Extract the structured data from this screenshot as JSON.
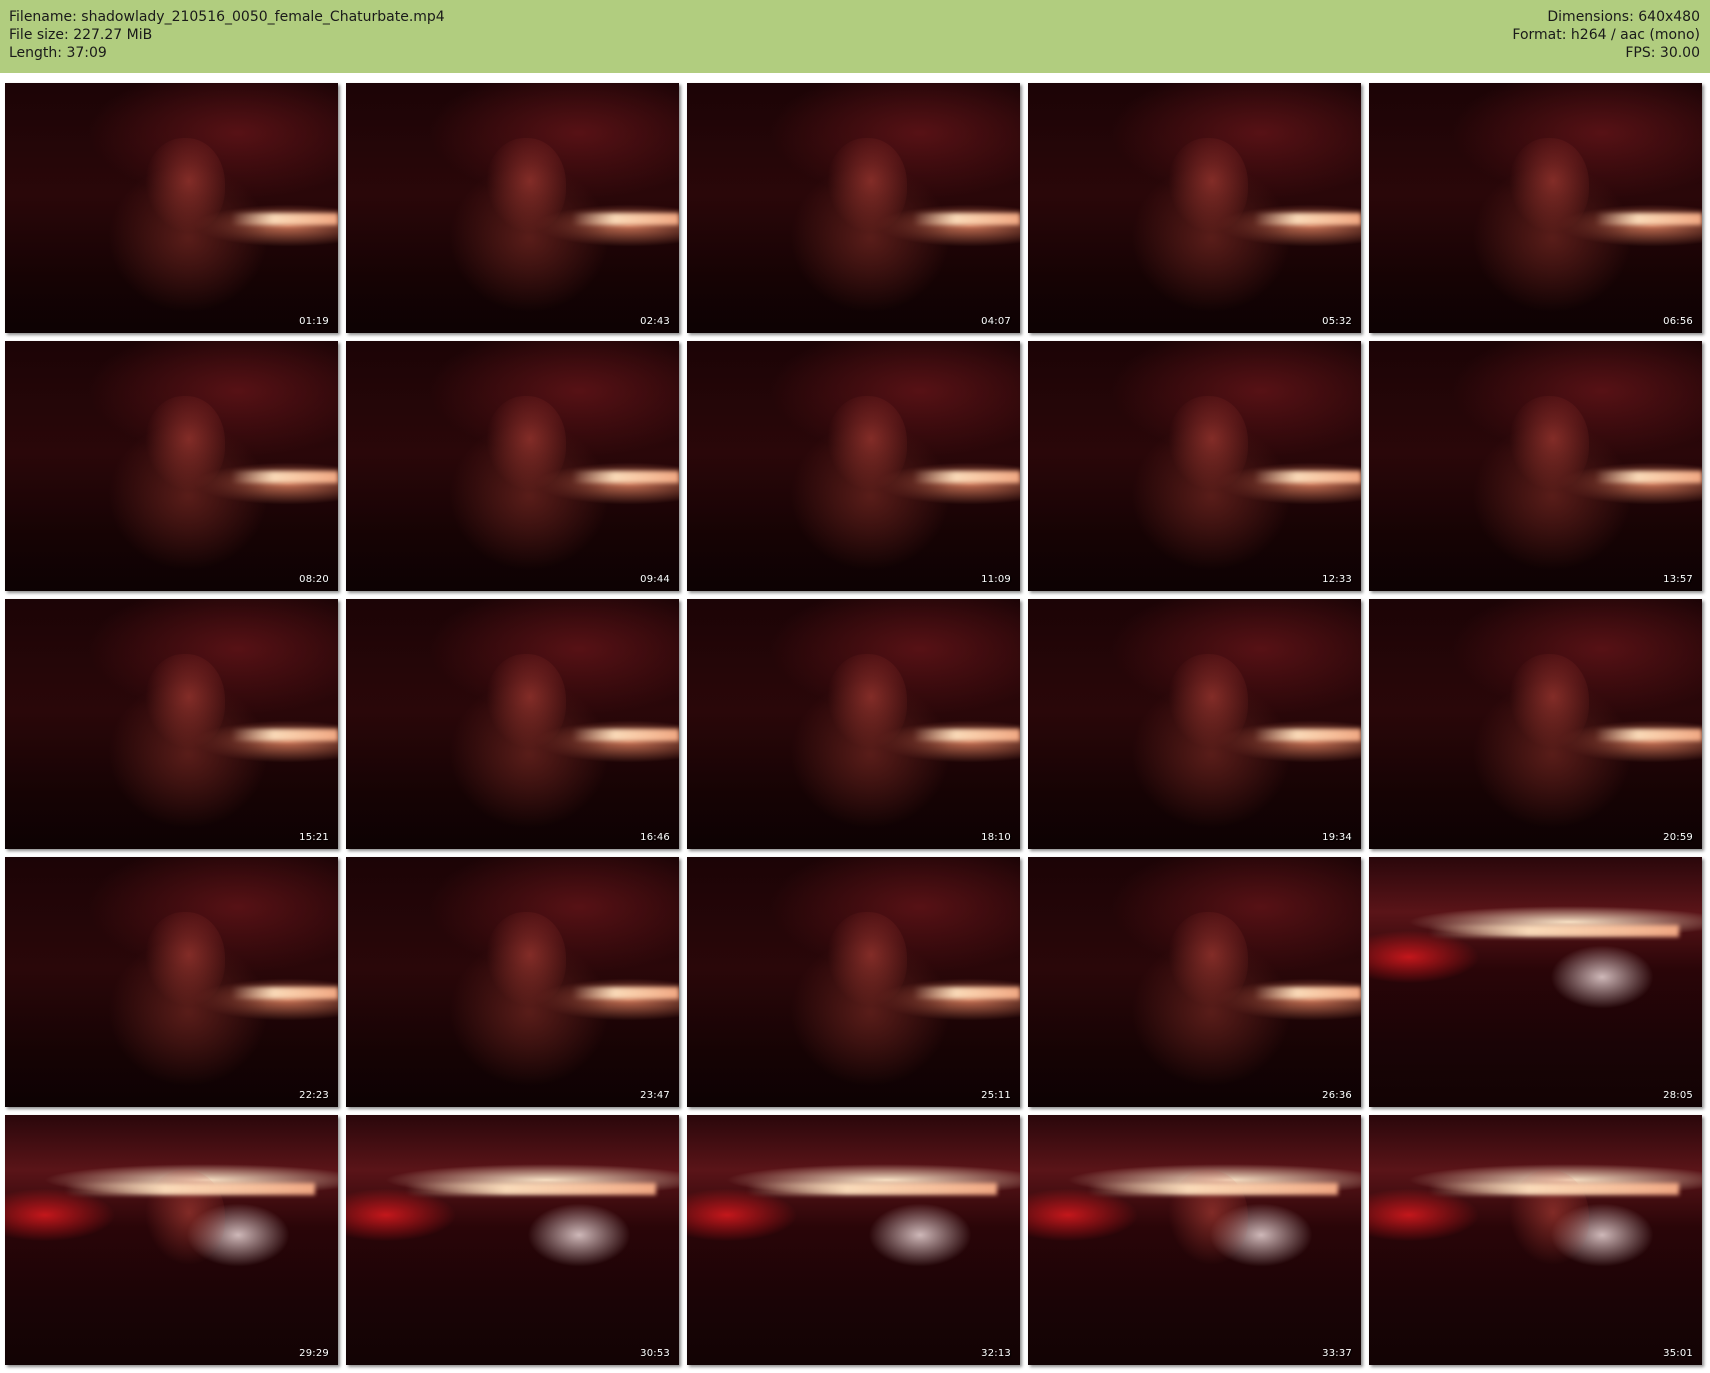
{
  "header": {
    "filename": "Filename: shadowlady_210516_0050_female_Chaturbate.mp4",
    "filesize": "File size: 227.27 MiB",
    "length": "Length: 37:09",
    "dimensions": "Dimensions: 640x480",
    "format": "Format: h264 / aac (mono)",
    "fps": "FPS: 30.00",
    "background_color": "#b1cd7f"
  },
  "thumbnails": [
    {
      "timestamp": "01:19"
    },
    {
      "timestamp": "02:43"
    },
    {
      "timestamp": "04:07"
    },
    {
      "timestamp": "05:32"
    },
    {
      "timestamp": "06:56"
    },
    {
      "timestamp": "08:20"
    },
    {
      "timestamp": "09:44"
    },
    {
      "timestamp": "11:09"
    },
    {
      "timestamp": "12:33"
    },
    {
      "timestamp": "13:57"
    },
    {
      "timestamp": "15:21"
    },
    {
      "timestamp": "16:46"
    },
    {
      "timestamp": "18:10"
    },
    {
      "timestamp": "19:34"
    },
    {
      "timestamp": "20:59"
    },
    {
      "timestamp": "22:23"
    },
    {
      "timestamp": "23:47"
    },
    {
      "timestamp": "25:11"
    },
    {
      "timestamp": "26:36"
    },
    {
      "timestamp": "28:05"
    },
    {
      "timestamp": "29:29"
    },
    {
      "timestamp": "30:53"
    },
    {
      "timestamp": "32:13"
    },
    {
      "timestamp": "33:37"
    },
    {
      "timestamp": "35:01"
    }
  ]
}
